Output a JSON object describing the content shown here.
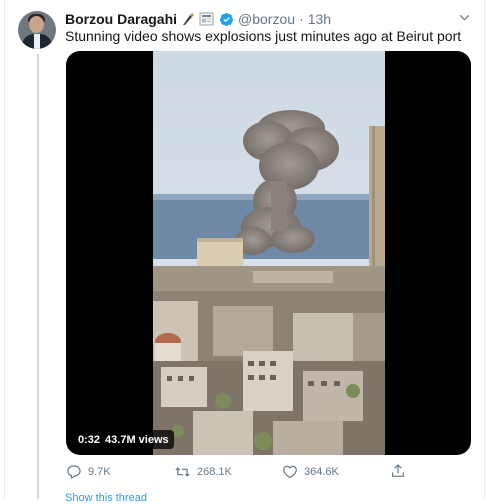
{
  "tweet": {
    "author_name": "Borzou Daragahi",
    "name_emoji": "🖋️📰",
    "handle": "@borzou",
    "separator": "·",
    "time": "13h",
    "text": "Stunning video shows explosions just minutes ago at Beirut port"
  },
  "media": {
    "duration": "0:32",
    "views": "43.7M views"
  },
  "actions": {
    "replies": "9.7K",
    "retweets": "268.1K",
    "likes": "364.6K"
  },
  "footer": {
    "show_thread": "Show this thread"
  },
  "colors": {
    "brand": "#1da1f2",
    "muted": "#657786",
    "text": "#14171a"
  }
}
